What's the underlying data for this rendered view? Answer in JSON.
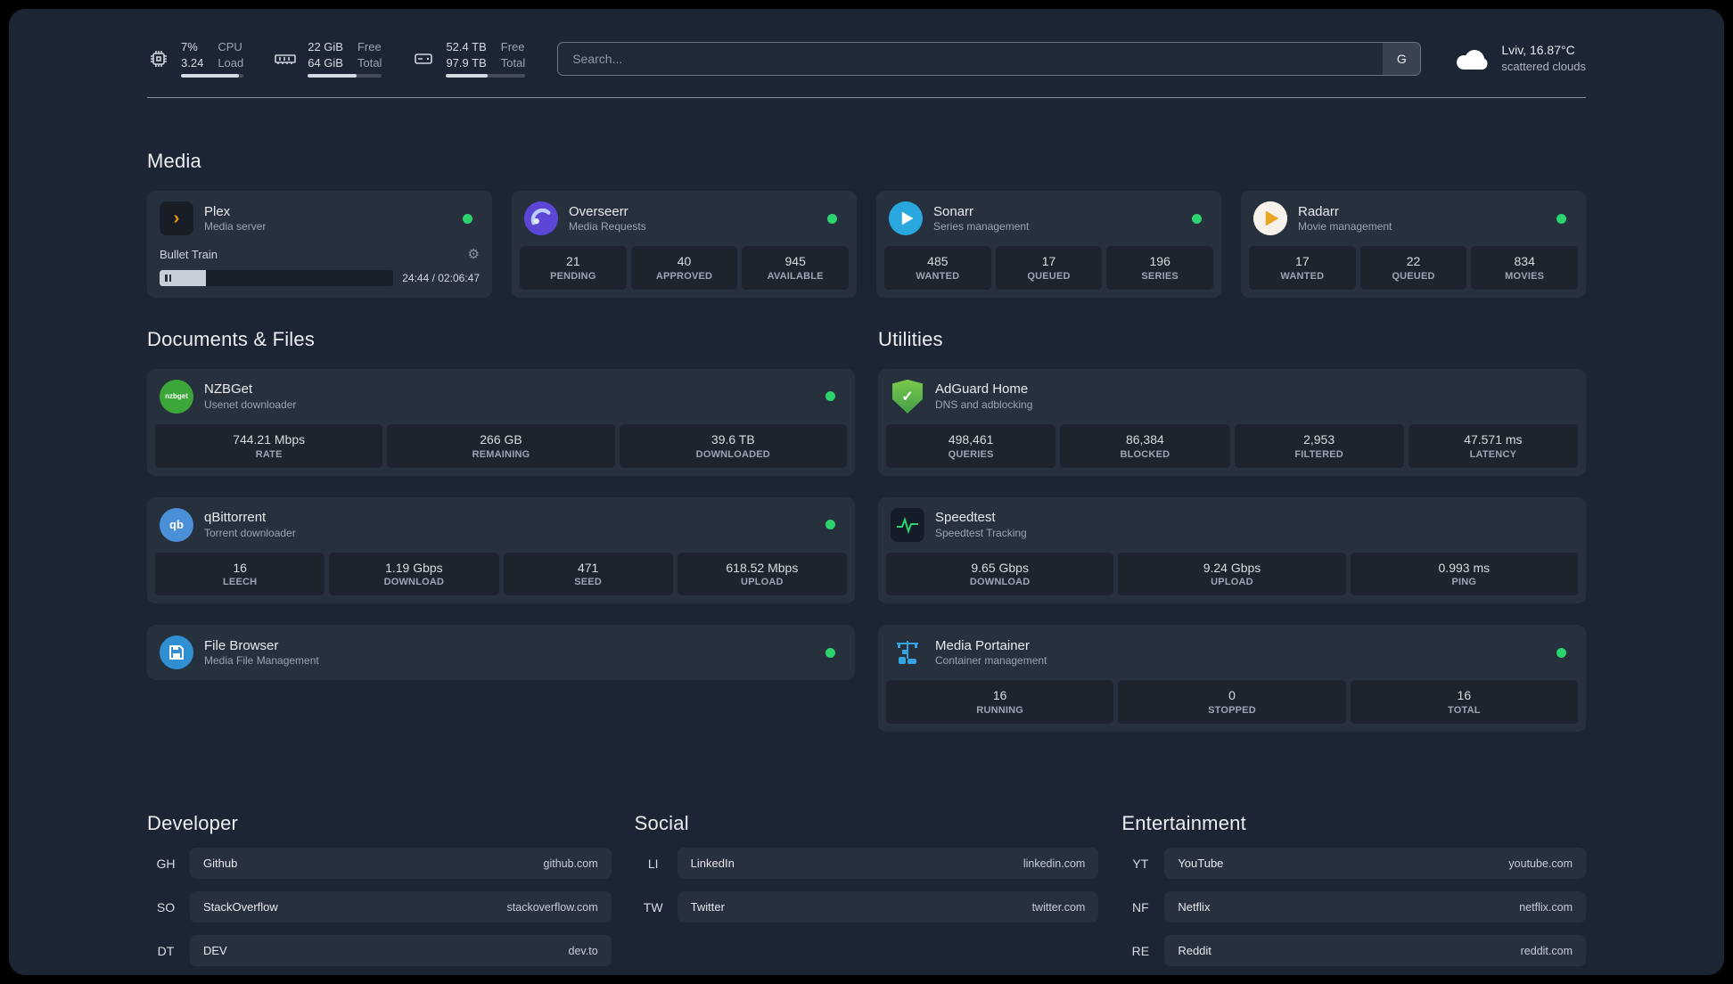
{
  "topbar": {
    "cpu": {
      "percent": "7%",
      "load": "3.24",
      "label_top": "CPU",
      "label_bottom": "Load",
      "meter": 93
    },
    "memory": {
      "free": "22 GiB",
      "total": "64 GiB",
      "label_top": "Free",
      "label_bottom": "Total",
      "meter": 66
    },
    "disk": {
      "free": "52.4 TB",
      "total": "97.9 TB",
      "label_top": "Free",
      "label_bottom": "Total",
      "meter": 53
    },
    "search": {
      "placeholder": "Search...",
      "provider": "G"
    },
    "weather": {
      "location": "Lviv, 16.87°C",
      "condition": "scattered clouds"
    }
  },
  "icons": {
    "plex_glyph": "›",
    "nzbget_label": "nzbget",
    "qbittorrent_label": "qb",
    "adguard_check": "✓",
    "gear": "⚙"
  },
  "media": {
    "title": "Media",
    "plex": {
      "name": "Plex",
      "subtitle": "Media server",
      "now_playing": "Bullet Train",
      "time": "24:44 / 02:06:47",
      "progress": 20
    },
    "overseerr": {
      "name": "Overseerr",
      "subtitle": "Media Requests",
      "stats": [
        {
          "value": "21",
          "label": "PENDING"
        },
        {
          "value": "40",
          "label": "APPROVED"
        },
        {
          "value": "945",
          "label": "AVAILABLE"
        }
      ]
    },
    "sonarr": {
      "name": "Sonarr",
      "subtitle": "Series management",
      "stats": [
        {
          "value": "485",
          "label": "WANTED"
        },
        {
          "value": "17",
          "label": "QUEUED"
        },
        {
          "value": "196",
          "label": "SERIES"
        }
      ]
    },
    "radarr": {
      "name": "Radarr",
      "subtitle": "Movie management",
      "stats": [
        {
          "value": "17",
          "label": "WANTED"
        },
        {
          "value": "22",
          "label": "QUEUED"
        },
        {
          "value": "834",
          "label": "MOVIES"
        }
      ]
    }
  },
  "documents": {
    "title": "Documents & Files",
    "nzbget": {
      "name": "NZBGet",
      "subtitle": "Usenet downloader",
      "stats": [
        {
          "value": "744.21 Mbps",
          "label": "RATE"
        },
        {
          "value": "266 GB",
          "label": "REMAINING"
        },
        {
          "value": "39.6 TB",
          "label": "DOWNLOADED"
        }
      ]
    },
    "qbittorrent": {
      "name": "qBittorrent",
      "subtitle": "Torrent downloader",
      "stats": [
        {
          "value": "16",
          "label": "LEECH"
        },
        {
          "value": "1.19 Gbps",
          "label": "DOWNLOAD"
        },
        {
          "value": "471",
          "label": "SEED"
        },
        {
          "value": "618.52 Mbps",
          "label": "UPLOAD"
        }
      ]
    },
    "filebrowser": {
      "name": "File Browser",
      "subtitle": "Media File Management"
    }
  },
  "utilities": {
    "title": "Utilities",
    "adguard": {
      "name": "AdGuard Home",
      "subtitle": "DNS and adblocking",
      "stats": [
        {
          "value": "498,461",
          "label": "QUERIES"
        },
        {
          "value": "86,384",
          "label": "BLOCKED"
        },
        {
          "value": "2,953",
          "label": "FILTERED"
        },
        {
          "value": "47.571 ms",
          "label": "LATENCY"
        }
      ]
    },
    "speedtest": {
      "name": "Speedtest",
      "subtitle": "Speedtest Tracking",
      "stats": [
        {
          "value": "9.65 Gbps",
          "label": "DOWNLOAD"
        },
        {
          "value": "9.24 Gbps",
          "label": "UPLOAD"
        },
        {
          "value": "0.993 ms",
          "label": "PING"
        }
      ]
    },
    "portainer": {
      "name": "Media Portainer",
      "subtitle": "Container management",
      "stats": [
        {
          "value": "16",
          "label": "RUNNING"
        },
        {
          "value": "0",
          "label": "STOPPED"
        },
        {
          "value": "16",
          "label": "TOTAL"
        }
      ]
    }
  },
  "bookmarks": [
    {
      "title": "Developer",
      "items": [
        {
          "abbr": "GH",
          "name": "Github",
          "url": "github.com"
        },
        {
          "abbr": "SO",
          "name": "StackOverflow",
          "url": "stackoverflow.com"
        },
        {
          "abbr": "DT",
          "name": "DEV",
          "url": "dev.to"
        }
      ]
    },
    {
      "title": "Social",
      "items": [
        {
          "abbr": "LI",
          "name": "LinkedIn",
          "url": "linkedin.com"
        },
        {
          "abbr": "TW",
          "name": "Twitter",
          "url": "twitter.com"
        }
      ]
    },
    {
      "title": "Entertainment",
      "items": [
        {
          "abbr": "YT",
          "name": "YouTube",
          "url": "youtube.com"
        },
        {
          "abbr": "NF",
          "name": "Netflix",
          "url": "netflix.com"
        },
        {
          "abbr": "RE",
          "name": "Reddit",
          "url": "reddit.com"
        }
      ]
    }
  ]
}
